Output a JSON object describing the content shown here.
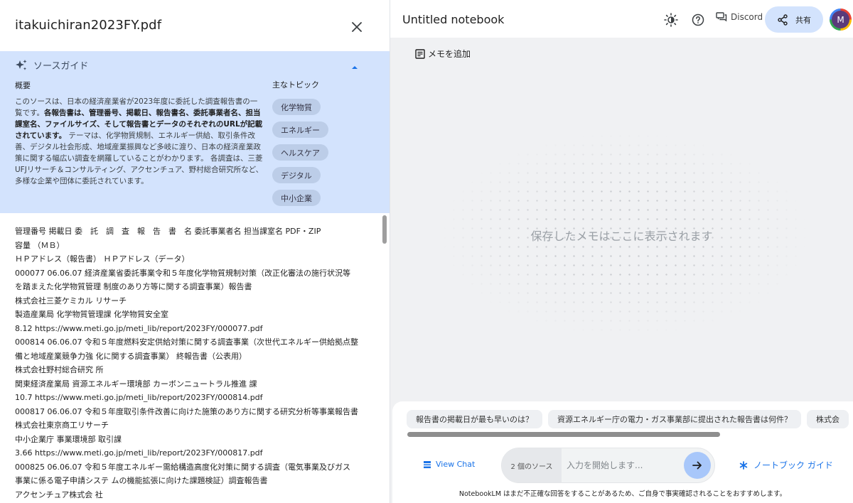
{
  "source_panel": {
    "file_title": "itakuichiran2023FY.pdf",
    "guide": {
      "title": "ソースガイド",
      "summary_label": "概要",
      "summary_intro": "このソースは、日本の経済産業省が2023年度に委託した調査報告書の一覧です。",
      "summary_bold": "各報告書は、管理番号、掲載日、報告書名、委託事業者名、担当課室名、ファイルサイズ、そして報告書とデータのそれぞれのURLが記載されています。",
      "summary_rest": " テーマは、化学物質規制、エネルギー供給、取引条件改善、デジタル社会形成、地域産業振興など多岐に渡り、日本の経済産業政策に関する幅広い調査を網羅していることがわかります。 各調査は、三菱UFJリサーチ＆コンサルティング、アクセンチュア、野村総合研究所など、多様な企業や団体に委託されています。",
      "topics_label": "主なトピック",
      "topics": [
        "化学物質",
        "エネルギー",
        "ヘルスケア",
        "デジタル",
        "中小企業"
      ]
    },
    "document_lines": [
      "管理番号 掲載日 委　託　調　査　報　告　書　名 委託事業者名 担当課室名 PDF・ZIP",
      "容量 （ＭＢ）",
      "ＨＰアドレス（報告書） ＨＰアドレス（データ）",
      "000077 06.06.07 経済産業省委託事業令和５年度化学物質規制対策（改正化審法の施行状況等",
      "を踏まえた化学物質管理 制度のあり方等に関する調査事業）報告書",
      "株式会社三菱ケミカル リサーチ",
      "製造産業局 化学物質管理課 化学物質安全室",
      "8.12 https://www.meti.go.jp/meti_lib/report/2023FY/000077.pdf",
      "000814 06.06.07 令和５年度燃料安定供給対策に関する調査事業（次世代エネルギー供給拠点整",
      "備と地域産業競争力強 化に関する調査事業） 終報告書（公表用）",
      "株式会社野村総合研究 所",
      "関東経済産業局 資源エネルギー環境部 カーボンニュートラル推進 課",
      "10.7 https://www.meti.go.jp/meti_lib/report/2023FY/000814.pdf",
      "000817 06.06.07 令和５年度取引条件改善に向けた施策のあり方に関する研究分析等事業報告書",
      "株式会社東京商工リサーチ",
      "中小企業庁 事業環境部 取引課",
      "3.66 https://www.meti.go.jp/meti_lib/report/2023FY/000817.pdf",
      "000825 06.06.07 令和５年度エネルギー需給構造高度化対策に関する調査（電気事業及びガス",
      "事業に係る電子申請システ ムの機能拡張に向けた課題検証）調査報告書",
      "アクセンチュア株式会 社"
    ]
  },
  "notebook": {
    "title": "Untitled notebook",
    "discord_label": "Discord",
    "share_label": "共有",
    "avatar_initial": "M",
    "add_memo_label": "メモを追加",
    "empty_message": "保存したメモはここに表示されます"
  },
  "chat": {
    "suggestions": [
      "報告書の掲載日が最も早いのは？",
      "資源エネルギー庁の電力・ガス事業部に提出された報告書は何件？",
      "株式会"
    ],
    "view_chat_label": "View Chat",
    "source_count": "2 個のソース",
    "input_placeholder": "入力を開始します...",
    "notebook_guide_label": "ノートブック ガイド",
    "disclaimer": "NotebookLM はまだ不正確な回答をすることがあるため、ご自身で事実確認されることをおすすめします。"
  },
  "colors": {
    "guide_bg": "#d3e3fd",
    "chip_bg": "#bccde8",
    "accent": "#1a73e8",
    "send_bg": "#a8c7fa",
    "right_bg": "#f0f1f3"
  }
}
